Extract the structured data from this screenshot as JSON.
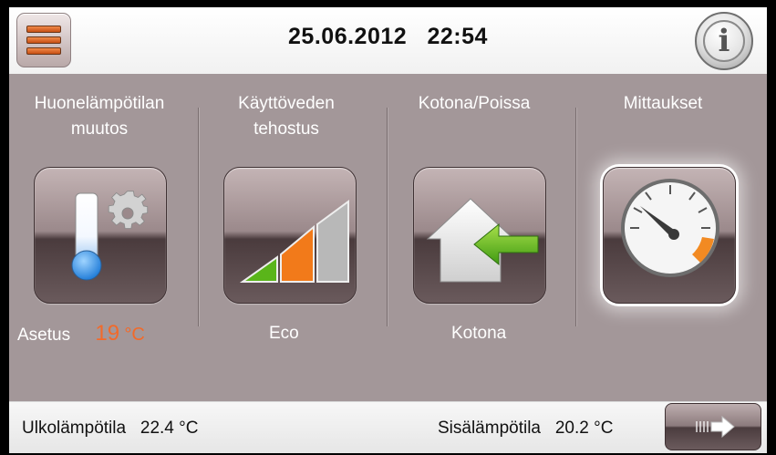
{
  "header": {
    "date": "25.06.2012",
    "time": "22:54",
    "menu_icon": "hamburger-menu-icon",
    "info_icon": "info-icon",
    "info_glyph": "i"
  },
  "tiles": [
    {
      "label": "Huonelämpötilan\nmuutos",
      "icon": "thermometer-gear-icon",
      "status_label": "Asetus",
      "status_value": "19",
      "status_unit": "°C"
    },
    {
      "label": "Käyttöveden\ntehostus",
      "icon": "boost-level-icon",
      "status_value": "Eco"
    },
    {
      "label": "Kotona/Poissa",
      "icon": "home-away-icon",
      "status_value": "Kotona"
    },
    {
      "label": "Mittaukset",
      "icon": "gauge-icon",
      "selected": true
    }
  ],
  "footer": {
    "outdoor_label": "Ulkolämpötila",
    "outdoor_value": "22.4",
    "indoor_label": "Sisälämpötila",
    "indoor_value": "20.2",
    "unit": "°C",
    "next_icon": "arrow-right-icon"
  },
  "colors": {
    "background": "#a39799",
    "accent": "#f26a2a",
    "header": "#ffffff"
  }
}
